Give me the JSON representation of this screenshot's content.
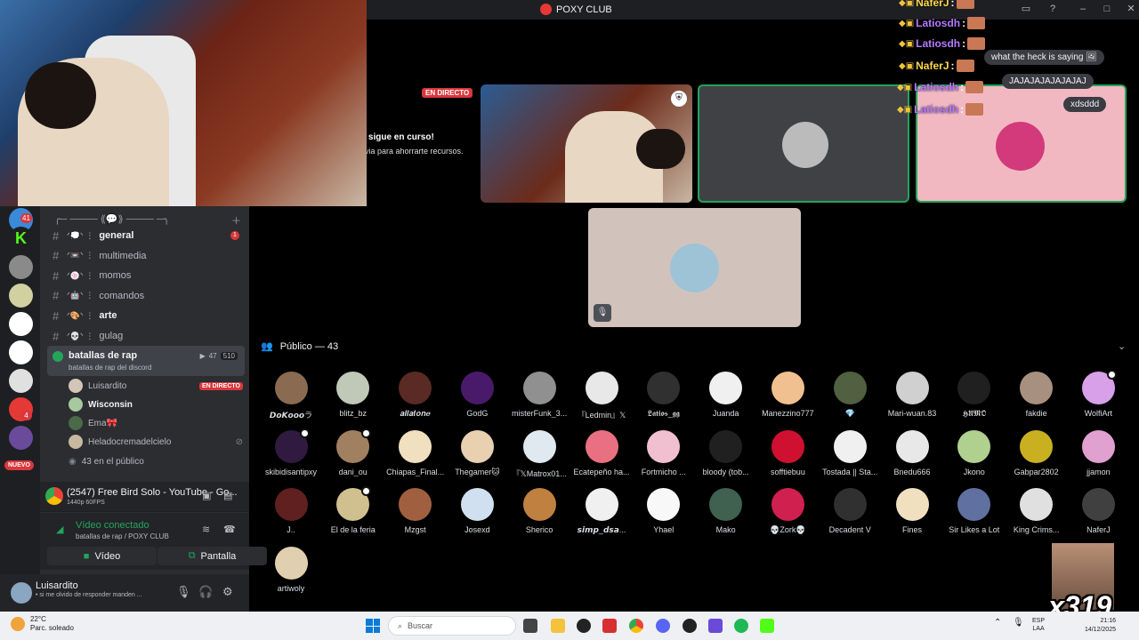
{
  "window": {
    "title": "POXY CLUB",
    "accent": "#23a55a",
    "live_color": "#da373c"
  },
  "stage": {
    "live_badge": "EN DIRECTO",
    "notice_title": "n sigue en curso!",
    "notice_sub": "evia para ahorrarte recursos."
  },
  "chat_overlay": {
    "lines": [
      {
        "user": "NaferJ",
        "color": "#ffd84a"
      },
      {
        "user": "Latiosdh",
        "color": "#b57aff"
      },
      {
        "user": "Latiosdh",
        "color": "#b57aff"
      },
      {
        "user": "NaferJ",
        "color": "#ffd84a"
      },
      {
        "user": "Latiosdh",
        "color": "#b57aff"
      },
      {
        "user": "Latiosdh",
        "color": "#b57aff"
      }
    ],
    "messages": [
      "what the heck is saying 🖼",
      "JAJAJAJAJAJAJAJ",
      "xdsddd"
    ]
  },
  "sidebar": {
    "category": "╭─ ──── ⟪💬⟫ ──── ─╮",
    "channels": [
      {
        "deco": "ᐟ💭ᐠ ⋮",
        "name": "general",
        "unread": "1",
        "bright": true
      },
      {
        "deco": "ᐟ📼ᐠ ⋮",
        "name": "multimedia",
        "bright": false
      },
      {
        "deco": "ᐟ🍥ᐠ ⋮",
        "name": "momos",
        "bright": false
      },
      {
        "deco": "ᐟ🤖ᐠ ⋮",
        "name": "comandos",
        "bright": false
      },
      {
        "deco": "ᐟ🎨ᐠ ⋮",
        "name": "arte",
        "bright": true
      },
      {
        "deco": "ᐟ💀ᐠ ⋮",
        "name": "gulag",
        "bright": false
      }
    ],
    "voice_channel": {
      "name": "batallas de rap",
      "subtitle": "batallas de rap del discord",
      "video_count": "47",
      "limit": "510",
      "users": [
        {
          "name": "Luisardito",
          "live": "EN DIRECTO"
        },
        {
          "name": "Wisconsin"
        },
        {
          "name": "Ema🎀"
        },
        {
          "name": "Heladocremadelcielo"
        }
      ],
      "audience": "43 en el público"
    },
    "now_playing": {
      "title": "(2547) Free Bird Solo - YouTube - Go...",
      "sub": "1440p 60FPS"
    },
    "voice_connected": {
      "title": "Vídeo conectado",
      "sub": "batallas de rap / POXY CLUB",
      "video_btn": "Vídeo",
      "screen_btn": "Pantalla"
    },
    "user": {
      "name": "Luisardito",
      "status": "• si me olvido de responder manden ..."
    }
  },
  "rail": {
    "badges": [
      "41",
      "4"
    ],
    "nuevo": "NUEVO"
  },
  "audience": {
    "title": "Público — 43",
    "members": [
      "𝘿𝙤𝙆𝙤𝙤𝙤ラ",
      "blitz_bz",
      "𝒂𝒍𝒍𝒂𝒕𝒐𝒏𝒆",
      "GodG",
      "misterFunk_3...",
      "『Ledmin』𝕏",
      "𝕷𝖆𝖙𝖎𝖔𝖘_𝖌𝖌",
      "Juanda",
      "Manezzino777",
      "💎",
      "Mari-wuan.83",
      "𝕳𝖀𝕸𝕺",
      "fakdie",
      "WolfiArt",
      "skibidisantipxy",
      "dani_ou",
      "Chiapas_Final...",
      "Thegamer🐱",
      "『𝕏Matrox01...",
      "Ecatepeño ha...",
      "Fortmicho ...",
      "bloody (tob...",
      "sofftiebuu",
      "Tostada || Sta...",
      "Bnedu666",
      "Jkono",
      "Gabpar2802",
      "jjamon",
      "J..",
      "El de la feria",
      "Mzgst",
      "Josexd",
      "Sherico",
      "𝙨𝙞𝙢𝙥_𝙙𝙨𝙖...",
      "Yhael",
      "Mako",
      "💀Zork💀",
      "Decadent V",
      "Fines",
      "Sir Likes a Lot",
      "King Crims...",
      "NaferJ",
      "artiwoly"
    ],
    "colors": [
      "#8a6a50",
      "#c0c8b8",
      "#5a2a24",
      "#4a1a6a",
      "#909090",
      "#e8e8e8",
      "#303030",
      "#f0f0f0",
      "#f0c090",
      "#506040",
      "#d0d0d0",
      "#202020",
      "#a89080",
      "#d8a0e8",
      "#301a40",
      "#a08060",
      "#f0e0c0",
      "#e8d0b0",
      "#e0e8f0",
      "#e87080",
      "#f0c0d0",
      "#202020",
      "#d01030",
      "#f0f0f0",
      "#e8e8e8",
      "#b0d090",
      "#c8b020",
      "#e0a0d0",
      "#602020",
      "#d0c090",
      "#a06040",
      "#d0e0f0",
      "#c08040",
      "#f0f0f0",
      "#f8f8f8",
      "#406050",
      "#d02050",
      "#303030",
      "#f0e0c0",
      "#6070a0",
      "#e0e0e0",
      "#404040",
      "#e0d0b0"
    ],
    "marked": [
      13,
      14,
      15,
      29
    ]
  },
  "overlay": {
    "combo": "x319"
  },
  "taskbar": {
    "weather_temp": "22°C",
    "weather_desc": "Parc. soleado",
    "search_placeholder": "Buscar",
    "lang_top": "ESP",
    "lang_bottom": "LAA",
    "time": "21:16",
    "date": "14/12/2025"
  }
}
